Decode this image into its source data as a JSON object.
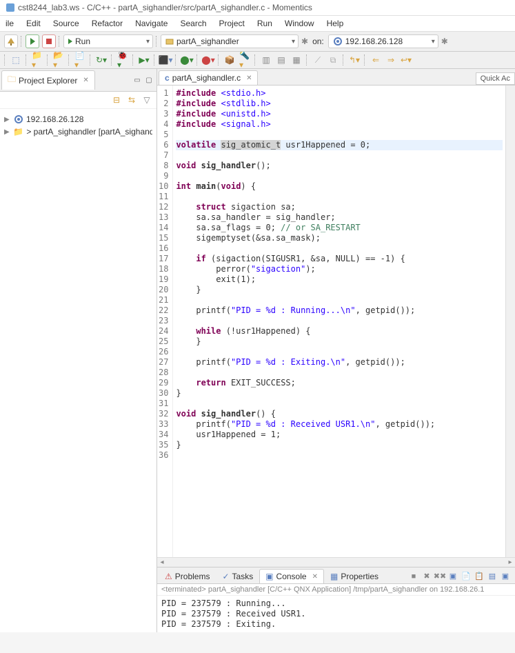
{
  "window": {
    "title": "cst8244_lab3.ws - C/C++ - partA_sighandler/src/partA_sighandler.c - Momentics"
  },
  "menu": [
    "ile",
    "Edit",
    "Source",
    "Refactor",
    "Navigate",
    "Search",
    "Project",
    "Run",
    "Window",
    "Help"
  ],
  "toolbar": {
    "run_mode": "Run",
    "active_project": "partA_sighandler",
    "on_label": "on:",
    "target_ip": "192.168.26.128"
  },
  "quick_access": "Quick Ac",
  "project_explorer": {
    "title": "Project Explorer",
    "items": [
      {
        "label": "192.168.26.128",
        "indent": 0
      },
      {
        "label": "> partA_sighandler [partA_sighandle",
        "indent": 0
      }
    ]
  },
  "editor": {
    "tab_label": "partA_sighandler.c",
    "lines": [
      {
        "n": 1,
        "html": "<span class='inc'>#include</span> <span class='str'>&lt;stdio.h&gt;</span>"
      },
      {
        "n": 2,
        "html": "<span class='inc'>#include</span> <span class='str'>&lt;stdlib.h&gt;</span>"
      },
      {
        "n": 3,
        "html": "<span class='inc'>#include</span> <span class='str'>&lt;unistd.h&gt;</span>"
      },
      {
        "n": 4,
        "html": "<span class='inc'>#include</span> <span class='str'>&lt;signal.h&gt;</span>"
      },
      {
        "n": 5,
        "html": ""
      },
      {
        "n": 6,
        "html": "<span class='kw'>volatile</span> <span class='hl-word'>sig_atomic_t</span> usr1Happened = 0;",
        "highlight": true
      },
      {
        "n": 7,
        "html": ""
      },
      {
        "n": 8,
        "html": "<span class='kw'>void</span> <span class='func'>sig_handler</span>();"
      },
      {
        "n": 9,
        "html": ""
      },
      {
        "n": 10,
        "html": "<span class='kw'>int</span> <span class='func'>main</span>(<span class='kw'>void</span>) {"
      },
      {
        "n": 11,
        "html": ""
      },
      {
        "n": 12,
        "html": "    <span class='kw'>struct</span> sigaction sa;"
      },
      {
        "n": 13,
        "html": "    sa.sa_handler = sig_handler;"
      },
      {
        "n": 14,
        "html": "    sa.sa_flags = 0; <span class='cm'>// or SA_RESTART</span>"
      },
      {
        "n": 15,
        "html": "    sigemptyset(&amp;sa.sa_mask);"
      },
      {
        "n": 16,
        "html": ""
      },
      {
        "n": 17,
        "html": "    <span class='kw'>if</span> (sigaction(SIGUSR1, &amp;sa, NULL) == -1) {"
      },
      {
        "n": 18,
        "html": "        perror(<span class='str'>\"sigaction\"</span>);"
      },
      {
        "n": 19,
        "html": "        exit(1);"
      },
      {
        "n": 20,
        "html": "    }"
      },
      {
        "n": 21,
        "html": ""
      },
      {
        "n": 22,
        "html": "    printf(<span class='str'>\"PID = %d : Running...\\n\"</span>, getpid());"
      },
      {
        "n": 23,
        "html": ""
      },
      {
        "n": 24,
        "html": "    <span class='kw'>while</span> (!usr1Happened) {"
      },
      {
        "n": 25,
        "html": "    }"
      },
      {
        "n": 26,
        "html": ""
      },
      {
        "n": 27,
        "html": "    printf(<span class='str'>\"PID = %d : Exiting.\\n\"</span>, getpid());"
      },
      {
        "n": 28,
        "html": ""
      },
      {
        "n": 29,
        "html": "    <span class='kw'>return</span> EXIT_SUCCESS;"
      },
      {
        "n": 30,
        "html": "}"
      },
      {
        "n": 31,
        "html": ""
      },
      {
        "n": 32,
        "html": "<span class='kw'>void</span> <span class='func'>sig_handler</span>() {"
      },
      {
        "n": 33,
        "html": "    printf(<span class='str'>\"PID = %d : Received USR1.\\n\"</span>, getpid());"
      },
      {
        "n": 34,
        "html": "    usr1Happened = 1;"
      },
      {
        "n": 35,
        "html": "}"
      },
      {
        "n": 36,
        "html": ""
      }
    ]
  },
  "bottom": {
    "tabs": [
      "Problems",
      "Tasks",
      "Console",
      "Properties"
    ],
    "active_tab": "Console",
    "console_status": "<terminated> partA_sighandler [C/C++ QNX Application] /tmp/partA_sighandler on 192.168.26.1",
    "console_output": "PID = 237579 : Running...\nPID = 237579 : Received USR1.\nPID = 237579 : Exiting."
  }
}
